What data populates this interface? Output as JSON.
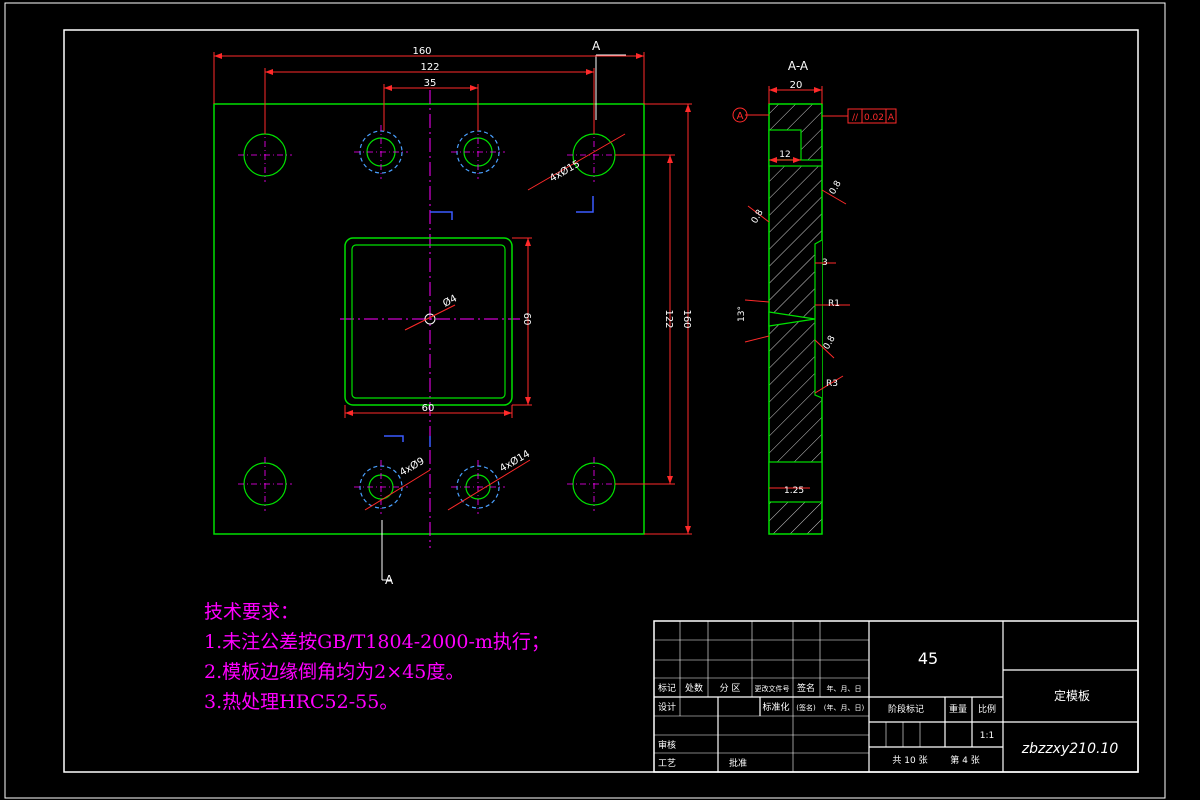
{
  "drawing": {
    "section_label_top": "A",
    "section_label_bottom": "A",
    "section_view_title": "A-A",
    "datum_label": "A",
    "dims_front": {
      "overall_width": "160",
      "hole_spacing_x": "122",
      "guide_spacing_x": "35",
      "hole_4x_d15": "4xØ15",
      "center_hole": "Ø4",
      "pocket_height": "60",
      "pocket_width": "60",
      "hole_spacing_y": "122",
      "overall_height": "160",
      "hole_4x_d9": "4xØ9",
      "hole_4x_d14": "4xØ14"
    },
    "dims_section": {
      "thickness": "20",
      "counterbore_depth": "12",
      "roughness_top": "0.8",
      "roughness_left": "0.8",
      "small_dim": "3",
      "fillet_r1": "R1",
      "taper_angle": "13°",
      "roughness_mid": "0.8",
      "fillet_r3": "R3",
      "bottom_dim": "1.25"
    },
    "tolerance": {
      "symbol": "//",
      "value": "0.02",
      "datum": "A"
    }
  },
  "tech_requirements": {
    "heading": "技术要求：",
    "item1": "1.未注公差按GB/T1804-2000-m执行；",
    "item2": "2.模板边缘倒角均为2×45度。",
    "item3": "3.热处理HRC52-55。"
  },
  "title_block": {
    "material": "45",
    "part_name": "定模板",
    "drawing_number": "zbzzxy210.10",
    "header_labels": [
      "标记",
      "处数",
      "分 区",
      "更改文件号",
      "签名",
      "年、月、日"
    ],
    "design": "设计",
    "std": "标准化",
    "sign": "(签名)",
    "date": "(年、月、日)",
    "stage": "阶段标记",
    "weight": "重量",
    "scale_label": "比例",
    "scale": "1:1",
    "review": "审核",
    "process": "工艺",
    "approve": "批准",
    "total": "共 10 张",
    "sheet": "第 4 张"
  }
}
